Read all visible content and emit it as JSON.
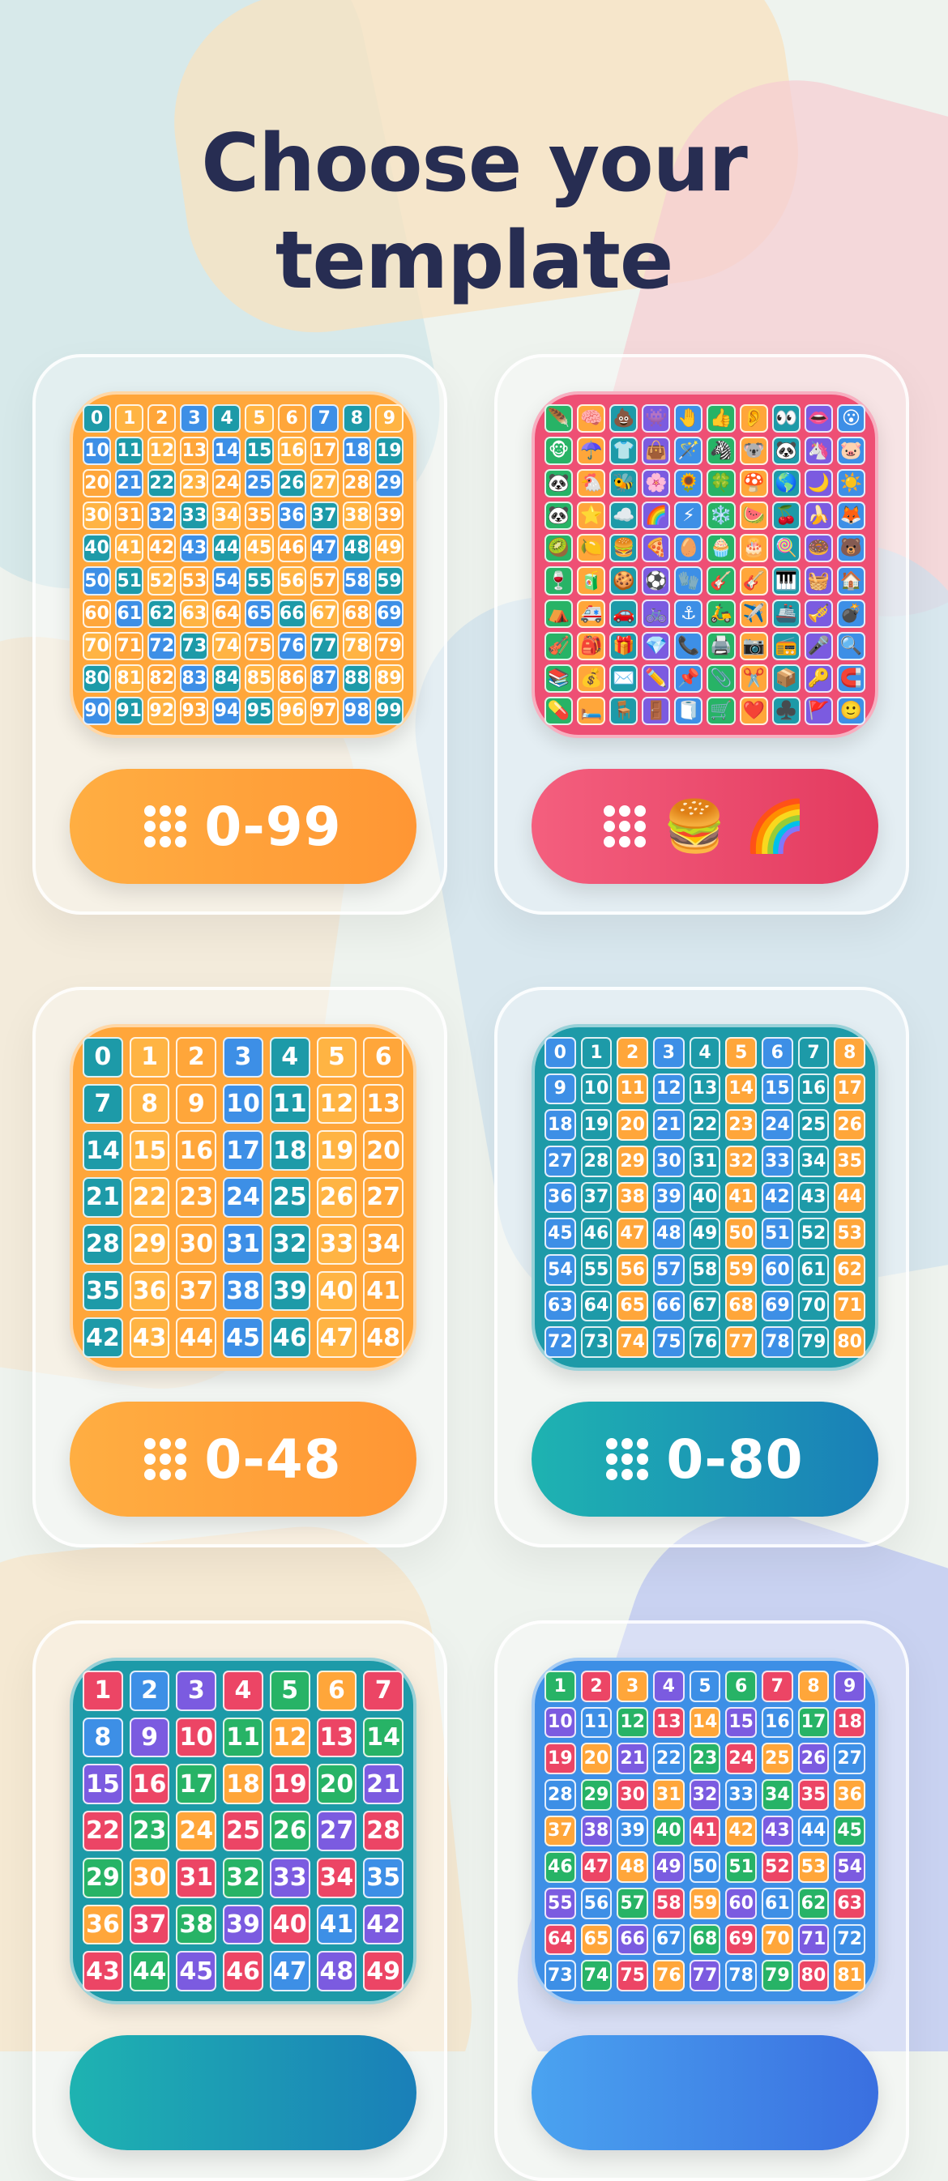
{
  "title": "Choose your template",
  "colors": {
    "navy": "#272d52",
    "orange": "#ffa63a",
    "pink": "#ee4f74",
    "teal": "#1d9aa8",
    "blue": "#3d8fe6",
    "green": "#27b366",
    "purple": "#7b5be0",
    "red": "#ec4565",
    "yellow": "#ffb443"
  },
  "templates": [
    {
      "id": "t1",
      "label": "0-99",
      "type": "numbers",
      "start": 0,
      "end": 99,
      "cols": 10,
      "board": "orange",
      "font": 22,
      "icon": "grid-dots-icon"
    },
    {
      "id": "t2",
      "label": "",
      "type": "emoji",
      "cols": 10,
      "board": "pink",
      "icon": "grid-dots-icon",
      "pill_emoji": [
        "🍔",
        "🌈"
      ],
      "emojis": [
        "🪶",
        "🧠",
        "💩",
        "👾",
        "🤚",
        "👍",
        "👂",
        "👀",
        "👄",
        "😮",
        "🐵",
        "☂️",
        "👕",
        "👜",
        "🪄",
        "🦓",
        "🐨",
        "🐼",
        "🦄",
        "🐷",
        "🐼",
        "🐔",
        "🐝",
        "🌸",
        "🌻",
        "🍀",
        "🍄",
        "🌎",
        "🌙",
        "☀️",
        "🐼",
        "⭐",
        "☁️",
        "🌈",
        "⚡",
        "❄️",
        "🍉",
        "🍒",
        "🍌",
        "🦊",
        "🥝",
        "🍋",
        "🍔",
        "🍕",
        "🥚",
        "🧁",
        "🎂",
        "🍭",
        "🍩",
        "🐻",
        "🍷",
        "🧃",
        "🍪",
        "⚽",
        "🧤",
        "🎸",
        "🎸",
        "🎹",
        "🧺",
        "🏠",
        "⛺",
        "🚑",
        "🚗",
        "🚲",
        "⚓",
        "🛵",
        "✈️",
        "🚢",
        "🎺",
        "💣",
        "🎻",
        "🎒",
        "🎁",
        "💎",
        "📞",
        "🖨️",
        "📷",
        "📻",
        "🎤",
        "🔍",
        "📚",
        "💰",
        "✉️",
        "✏️",
        "📌",
        "📎",
        "✂️",
        "📦",
        "🔑",
        "🧲",
        "💊",
        "🛏️",
        "🪑",
        "🚪",
        "🧻",
        "🛒",
        "❤️",
        "♣️",
        "🚩",
        "🙂"
      ]
    },
    {
      "id": "t3",
      "label": "0-48",
      "type": "numbers",
      "start": 0,
      "end": 48,
      "cols": 7,
      "board": "orange",
      "font": 30,
      "icon": "grid-dots-icon"
    },
    {
      "id": "t4",
      "label": "0-80",
      "type": "numbers",
      "start": 0,
      "end": 80,
      "cols": 9,
      "board": "teal",
      "font": 22,
      "icon": "grid-dots-icon"
    },
    {
      "id": "t5",
      "label": "",
      "type": "numbers",
      "start": 1,
      "end": 49,
      "cols": 7,
      "board": "teal",
      "font": 30,
      "icon": "grid-dots-icon"
    },
    {
      "id": "t6",
      "label": "",
      "type": "numbers",
      "start": 1,
      "end": 81,
      "cols": 9,
      "board": "blue",
      "font": 22,
      "icon": "grid-dots-icon"
    }
  ]
}
